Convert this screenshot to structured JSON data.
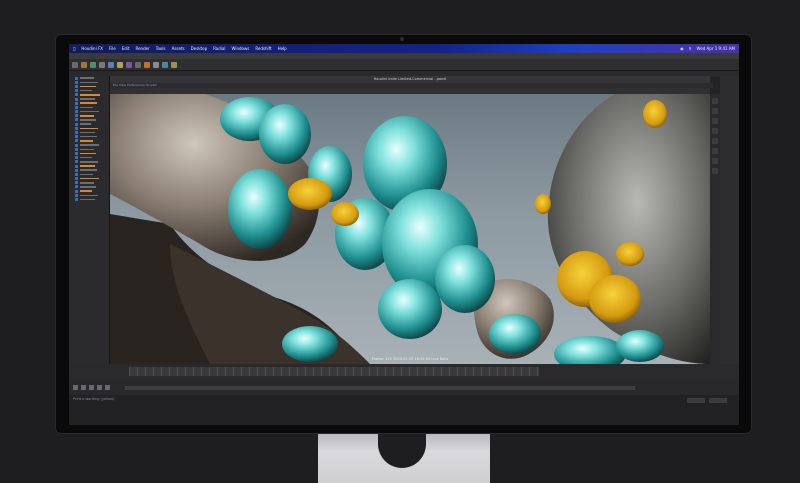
{
  "menubar": {
    "items": [
      "Houdini FX",
      "File",
      "Edit",
      "Render",
      "Tools",
      "Assets",
      "Desktop",
      "Radial",
      "Windows",
      "Redshift",
      "Help"
    ],
    "clock": "Wed Apr 1  9:41 AM"
  },
  "window": {
    "title": "Houdini Indie Limited-Commercial - panel"
  },
  "viewport": {
    "menu": "File  View  Preferences  Houdini",
    "frame_label": "Frame: 125   2020-02-25 18:34:04   Live Data"
  },
  "status": {
    "text": "Print a wanting (yellow)"
  },
  "colors": {
    "accent": "#d88a2c",
    "menubar": "#14238a",
    "teal": "#3fc6c4",
    "yellow": "#e8b417"
  }
}
